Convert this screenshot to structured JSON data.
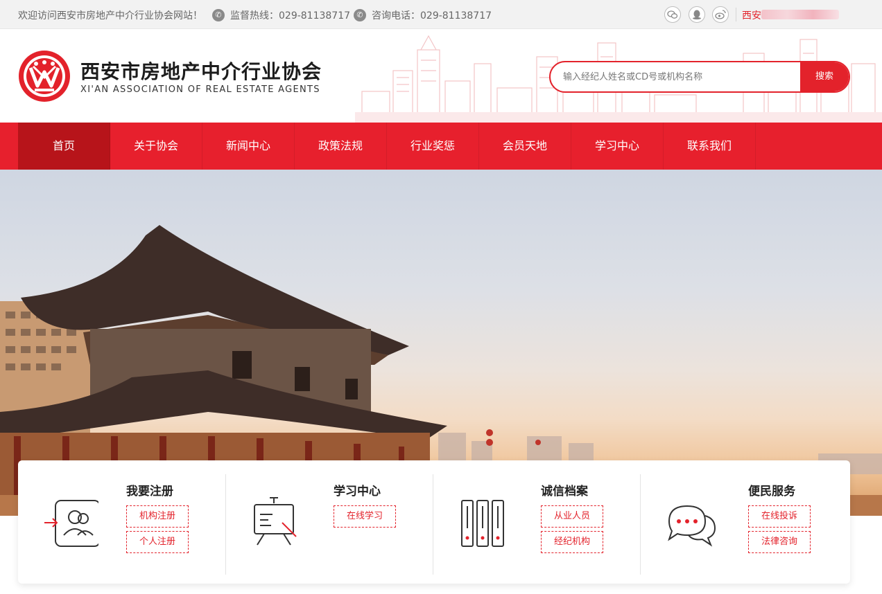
{
  "topbar": {
    "welcome": "欢迎访问西安市房地产中介行业协会网站！",
    "hotline_label": "监督热线：029-81138717",
    "consult_label": "咨询电话：029-81138717",
    "city_label": "西安",
    "social_icons": [
      "wechat-icon",
      "qq-icon",
      "weibo-icon"
    ]
  },
  "header": {
    "org_name_cn": "西安市房地产中介行业协会",
    "org_name_en": "XI'AN ASSOCIATION OF REAL ESTATE AGENTS",
    "search_placeholder": "输入经纪人姓名或CD号或机构名称",
    "search_button": "搜索"
  },
  "nav": {
    "items": [
      {
        "label": "首页",
        "active": true
      },
      {
        "label": "关于协会",
        "active": false
      },
      {
        "label": "新闻中心",
        "active": false
      },
      {
        "label": "政策法规",
        "active": false
      },
      {
        "label": "行业奖惩",
        "active": false
      },
      {
        "label": "会员天地",
        "active": false
      },
      {
        "label": "学习中心",
        "active": false
      },
      {
        "label": "联系我们",
        "active": false
      }
    ]
  },
  "services": [
    {
      "title": "我要注册",
      "icon": "register-user-icon",
      "links": [
        "机构注册",
        "个人注册"
      ]
    },
    {
      "title": "学习中心",
      "icon": "easel-board-icon",
      "links": [
        "在线学习"
      ]
    },
    {
      "title": "诚信档案",
      "icon": "archive-binders-icon",
      "links": [
        "从业人员",
        "经纪机构"
      ]
    },
    {
      "title": "便民服务",
      "icon": "chat-bubbles-icon",
      "links": [
        "在线投诉",
        "法律咨询"
      ]
    }
  ],
  "colors": {
    "brand_red": "#e7202d",
    "nav_active": "#b7141a",
    "topbar_bg": "#f2f2f2"
  }
}
